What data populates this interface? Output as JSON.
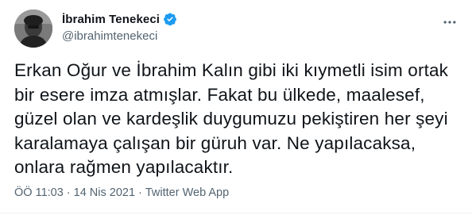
{
  "author": {
    "display_name": "İbrahim Tenekeci",
    "handle": "@ibrahimtenekeci",
    "verified": true
  },
  "tweet": {
    "text": "Erkan Oğur ve İbrahim Kalın gibi iki kıymetli isim ortak\nbir esere imza atmışlar. Fakat bu ülkede, maalesef,\ngüzel olan ve kardeşlik duygumuzu pekiştiren her şeyi\nkaralamaya çalışan bir güruh var. Ne yapılacaksa,\nonlara rağmen yapılacaktır.",
    "time": "ÖÖ 11:03",
    "date": "14 Nis 2021",
    "source": "Twitter Web App",
    "separator": "·"
  },
  "icons": {
    "avatar": "avatar-photo",
    "verified": "verified-badge-icon",
    "more": "more-options-icon"
  },
  "colors": {
    "verified_blue": "#1d9bf0",
    "text": "#0f1419",
    "secondary": "#536471"
  }
}
